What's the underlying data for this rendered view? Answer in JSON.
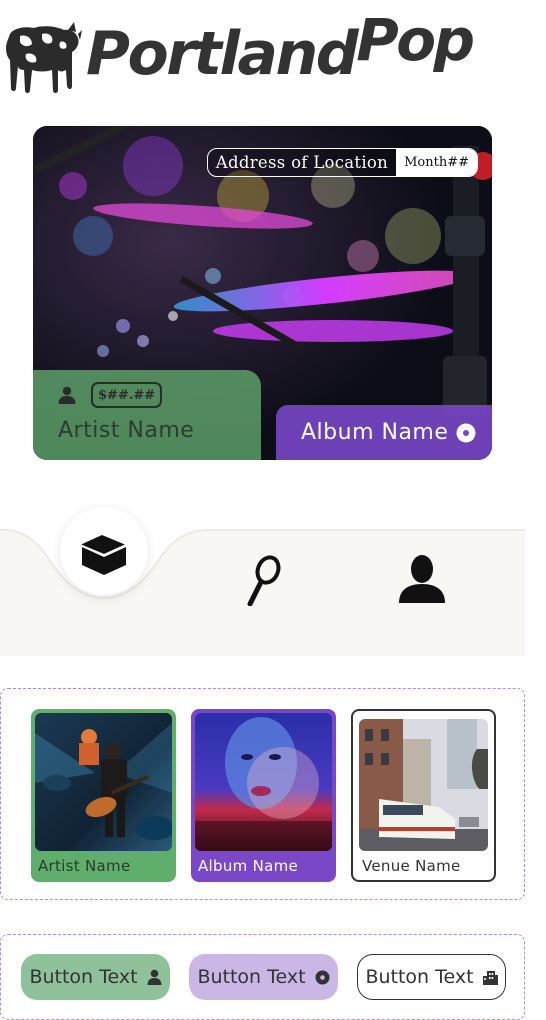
{
  "brand": {
    "name_part1": "Portland",
    "name_part2": "Pop",
    "logo_icon": "cow-icon"
  },
  "hero": {
    "address": "Address of Location",
    "month": "Month##",
    "price": "$##.##",
    "artist_name": "Artist Name",
    "album_name": "Album Name",
    "icons": [
      "person-icon",
      "disc-icon"
    ]
  },
  "tabs": [
    {
      "name": "home",
      "icon": "box-home-icon",
      "active": true
    },
    {
      "name": "search",
      "icon": "search-icon",
      "active": false
    },
    {
      "name": "profile",
      "icon": "user-icon",
      "active": false
    }
  ],
  "cards": [
    {
      "label": "Artist Name",
      "image": "concert-guitarist-photo"
    },
    {
      "label": "Album Name",
      "image": "album-cover-face"
    },
    {
      "label": "Venue Name",
      "image": "city-streetcar-photo"
    }
  ],
  "buttons": [
    {
      "label": "Button Text",
      "icon": "person-icon"
    },
    {
      "label": "Button Text",
      "icon": "disc-icon"
    },
    {
      "label": "Button Text",
      "icon": "building-icon"
    }
  ],
  "colors": {
    "green": "#5fae6c",
    "purple": "#7a47c8",
    "light_green": "#8fc29a",
    "light_purple": "#cbb7e6",
    "dashed_border": "#b583ea",
    "tabbar_bg": "#f8f7f3"
  }
}
